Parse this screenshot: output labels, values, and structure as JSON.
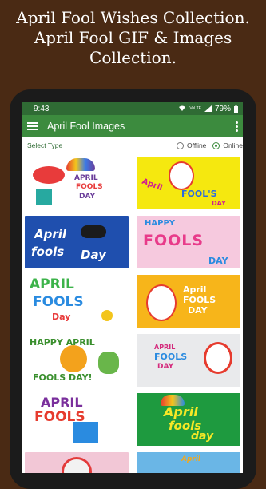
{
  "headline": {
    "line1": "April Fool Wishes Collection.",
    "line2": "April Fool GIF & Images",
    "line3": "Collection."
  },
  "status_bar": {
    "time": "9:43",
    "network": "VoLTE",
    "battery": "79%"
  },
  "toolbar": {
    "title": "April Fool Images"
  },
  "select_type": {
    "label": "Select Type",
    "options": [
      {
        "label": "Offline",
        "selected": false
      },
      {
        "label": "Online",
        "selected": true
      }
    ]
  },
  "images": [
    {
      "text1": "APRIL",
      "text2": "FOOLS",
      "text3": "DAY",
      "bg": "#ffffff",
      "accent": "#6a3d9a"
    },
    {
      "text1": "April",
      "text2": "FOOL'S",
      "text3": "DAY",
      "bg": "#f5e80f",
      "accent": "#d0208f"
    },
    {
      "text1": "April",
      "text2": "fools",
      "text3": "Day",
      "bg": "#1f4fae",
      "accent": "#ffffff"
    },
    {
      "text1": "HAPPY",
      "text2": "FOOLS",
      "text3": "DAY",
      "bg": "#f6c9de",
      "accent": "#2a8be0"
    },
    {
      "text1": "APRIL",
      "text2": "FOOLS",
      "text3": "Day",
      "bg": "#ffffff",
      "accent": "#3cb34a"
    },
    {
      "text1": "April",
      "text2": "FOOLS",
      "text3": "DAY",
      "bg": "#f7b51a",
      "accent": "#ffffff"
    },
    {
      "text1": "HAPPY APRIL",
      "text2": "FOOLS DAY!",
      "text3": "",
      "bg": "#ffffff",
      "accent": "#3a8f2e"
    },
    {
      "text1": "APRIL",
      "text2": "FOOLS",
      "text3": "DAY",
      "bg": "#e9eaec",
      "accent": "#d42a7c"
    },
    {
      "text1": "APRIL",
      "text2": "FOOLS",
      "text3": "",
      "bg": "#ffffff",
      "accent": "#7a2f9c"
    },
    {
      "text1": "April",
      "text2": "fools",
      "text3": "day",
      "bg": "#1e9a3f",
      "accent": "#f6e826"
    },
    {
      "text1": "",
      "text2": "",
      "text3": "",
      "bg": "#f2c7d6",
      "accent": "#e33b3b"
    },
    {
      "text1": "April",
      "text2": "",
      "text3": "",
      "bg": "#6ab6e6",
      "accent": "#f2a81d"
    }
  ]
}
